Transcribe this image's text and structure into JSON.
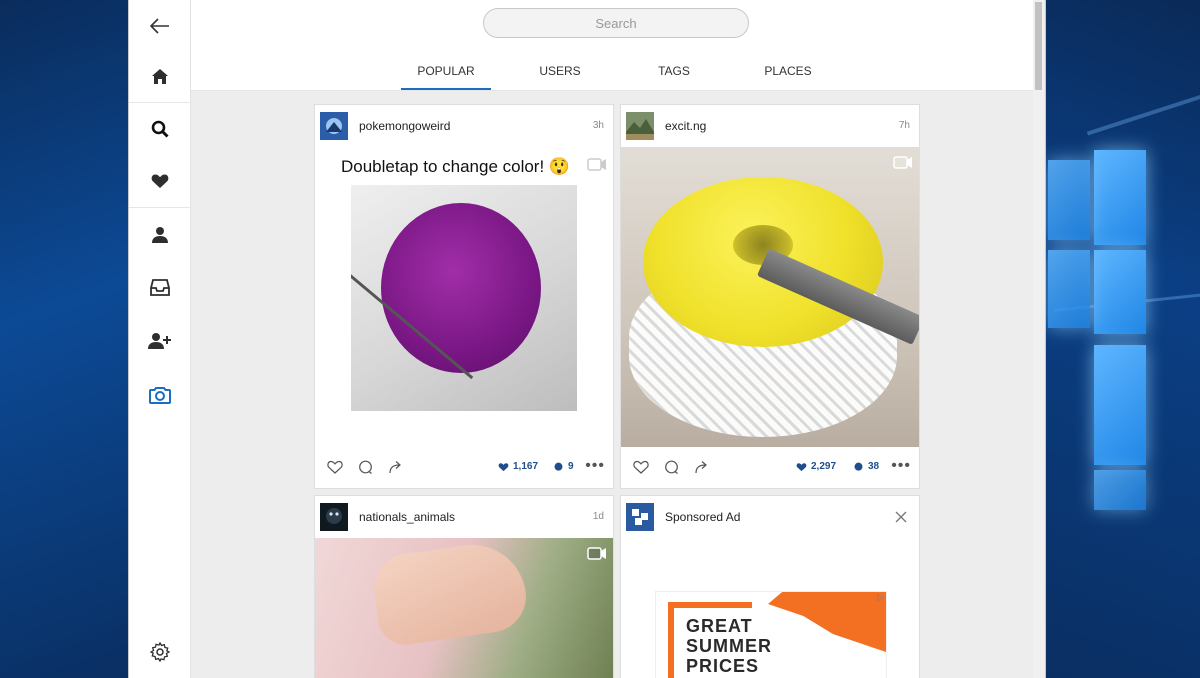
{
  "search": {
    "placeholder": "Search"
  },
  "tabs": [
    {
      "label": "POPULAR",
      "active": true
    },
    {
      "label": "USERS"
    },
    {
      "label": "TAGS"
    },
    {
      "label": "PLACES"
    }
  ],
  "sidebar": {
    "items": [
      {
        "icon": "back-arrow-icon"
      },
      {
        "icon": "home-icon"
      },
      {
        "icon": "search-icon",
        "active": true
      },
      {
        "icon": "heart-icon"
      },
      {
        "icon": "profile-icon"
      },
      {
        "icon": "inbox-icon"
      },
      {
        "icon": "add-user-icon"
      },
      {
        "icon": "camera-icon"
      },
      {
        "icon": "settings-gear-icon"
      }
    ]
  },
  "posts": [
    {
      "username": "pokemongoweird",
      "age": "3h",
      "caption": "Doubletap to change color! 😲",
      "likes": "1,167",
      "comments": "9",
      "media": "video"
    },
    {
      "username": "excit.ng",
      "age": "7h",
      "likes": "2,297",
      "comments": "38",
      "media": "video"
    },
    {
      "username": "nationals_animals",
      "age": "1d",
      "media": "video"
    },
    {
      "username": "Sponsored Ad",
      "ad_text": [
        "GREAT",
        "SUMMER",
        "PRICES"
      ],
      "ad_badge": "▷"
    }
  ],
  "colors": {
    "accent": "#1a6dc0",
    "stat": "#1f4e8c",
    "ad_orange": "#f36f21"
  }
}
